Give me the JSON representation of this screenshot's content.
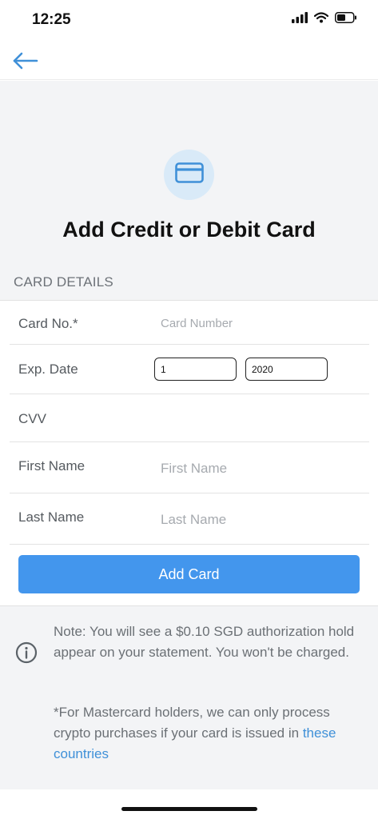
{
  "status_bar": {
    "time": "12:25",
    "icons": [
      "signal-icon",
      "wifi-icon",
      "battery-icon"
    ]
  },
  "nav": {
    "back_icon": "arrow-left-icon"
  },
  "header": {
    "icon": "credit-card-icon",
    "title": "Add Credit or Debit Card",
    "section_label": "CARD DETAILS"
  },
  "form": {
    "card_number": {
      "label": "Card No.*",
      "placeholder": "Card Number",
      "value": ""
    },
    "exp_date": {
      "label": "Exp. Date",
      "month": "1",
      "year": "2020"
    },
    "cvv": {
      "label": "CVV",
      "value": ""
    },
    "first_name": {
      "label": "First Name",
      "placeholder": "First Name",
      "value": ""
    },
    "last_name": {
      "label": "Last Name",
      "placeholder": "Last Name",
      "value": ""
    },
    "submit_label": "Add Card"
  },
  "note": {
    "icon": "info-icon",
    "text": "Note: You will see a $0.10 SGD authorization hold appear on your statement. You won't be charged.",
    "footnote_prefix": "*For Mastercard holders, we can only process crypto purchases if your card is issued in ",
    "footnote_link": "these countries"
  },
  "colors": {
    "accent": "#4396ed",
    "link": "#3f90d8",
    "background": "#f3f4f6",
    "icon_circle": "#d9eaf8"
  }
}
